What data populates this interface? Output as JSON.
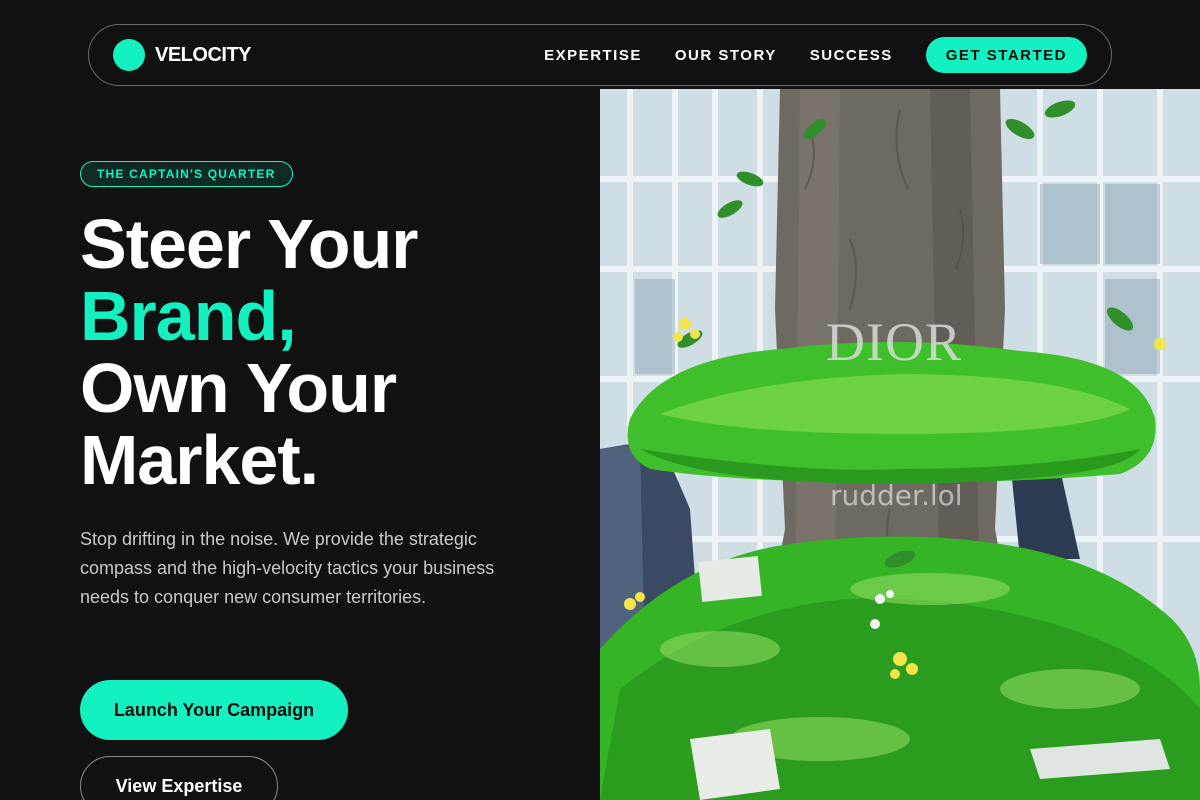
{
  "nav": {
    "brand": "VELOCITY",
    "links": [
      "EXPERTISE",
      "OUR STORY",
      "SUCCESS"
    ],
    "cta": "GET STARTED"
  },
  "hero": {
    "badge": "THE CAPTAIN'S QUARTER",
    "headline": [
      "Steer Your",
      "Brand,",
      "Own Your",
      "Market."
    ],
    "subtext": "Stop drifting in the noise. We provide the strategic compass and the high-velocity tactics your business needs to conquer new consumer territories.",
    "primary_button": "Launch Your Campaign",
    "secondary_button": "View Expertise"
  },
  "image": {
    "signage_text": "DIOR",
    "watermark": "rudder.lol"
  },
  "colors": {
    "background": "#111112",
    "accent": "#14f1c1",
    "text": "#ffffff",
    "muted_text": "#c9c9c9"
  }
}
